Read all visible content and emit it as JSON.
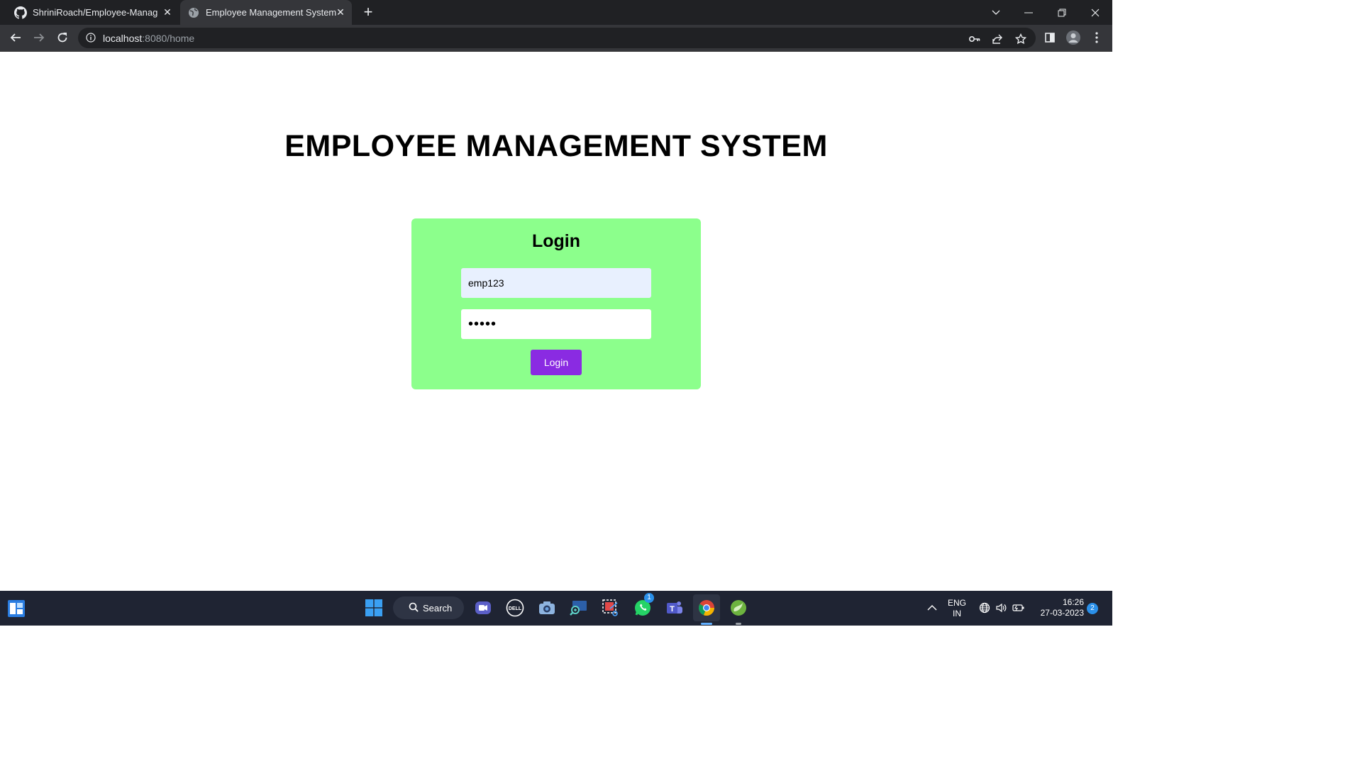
{
  "browser": {
    "tabs": [
      {
        "title": "ShriniRoach/Employee-Managem",
        "active": false
      },
      {
        "title": "Employee Management System",
        "active": true
      }
    ],
    "url_host": "localhost",
    "url_path": ":8080/home"
  },
  "page": {
    "title": "EMPLOYEE MANAGEMENT SYSTEM",
    "login": {
      "heading": "Login",
      "username_value": "emp123",
      "password_value": "•••••",
      "button_label": "Login"
    }
  },
  "taskbar": {
    "search_label": "Search",
    "whatsapp_badge": "1",
    "language_line1": "ENG",
    "language_line2": "IN",
    "time": "16:26",
    "date": "27-03-2023",
    "notifications": "2"
  },
  "colors": {
    "card": "#8cff8c",
    "button": "#8a2be2",
    "autofill": "#e8f0fe"
  }
}
